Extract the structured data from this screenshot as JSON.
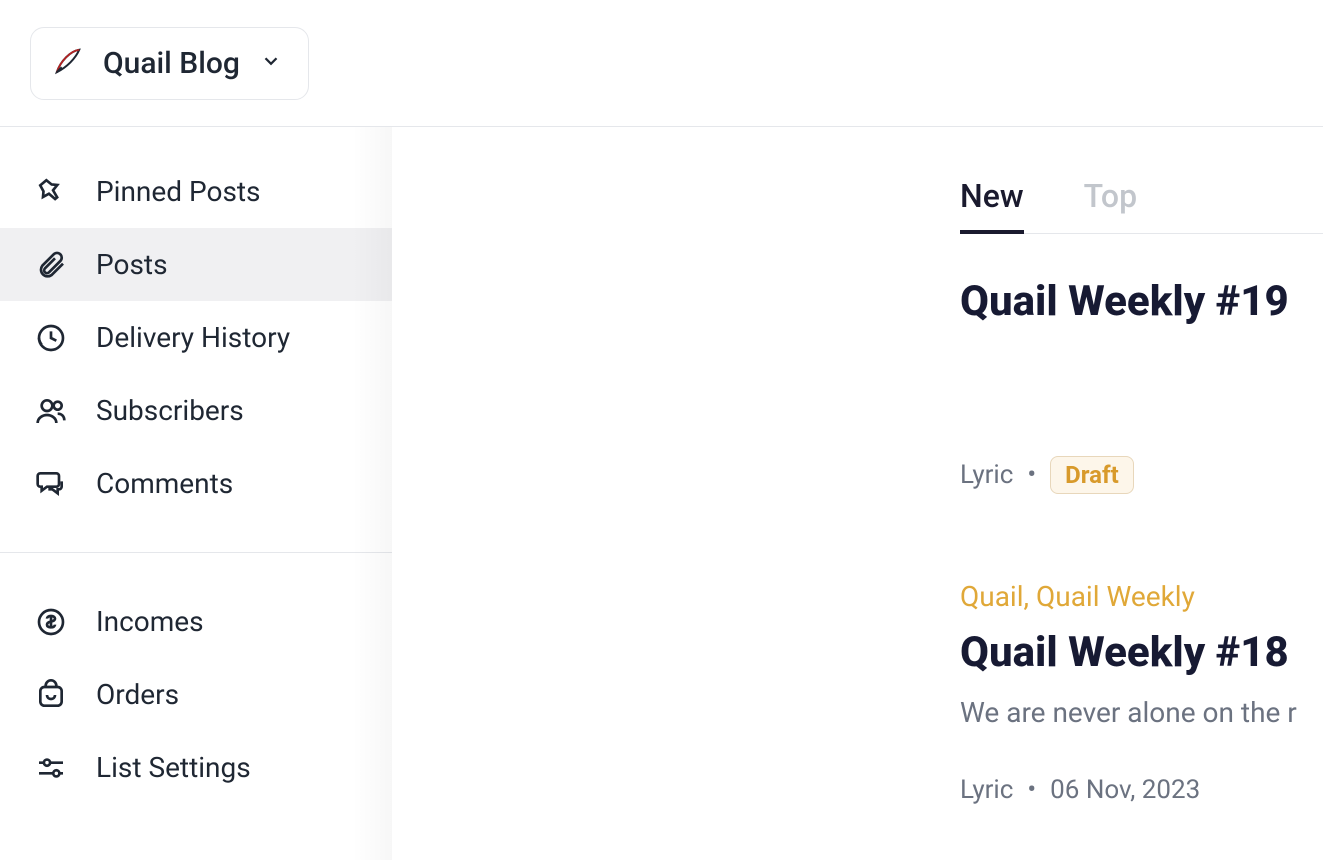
{
  "header": {
    "site_name": "Quail Blog"
  },
  "sidebar": {
    "section1": [
      {
        "key": "pinned",
        "label": "Pinned Posts"
      },
      {
        "key": "posts",
        "label": "Posts"
      },
      {
        "key": "delivery",
        "label": "Delivery History"
      },
      {
        "key": "subs",
        "label": "Subscribers"
      },
      {
        "key": "comments",
        "label": "Comments"
      }
    ],
    "section2": [
      {
        "key": "incomes",
        "label": "Incomes"
      },
      {
        "key": "orders",
        "label": "Orders"
      },
      {
        "key": "settings",
        "label": "List Settings"
      }
    ],
    "active_key": "posts"
  },
  "tabs": {
    "items": [
      "New",
      "Top"
    ],
    "active_index": 0
  },
  "posts": [
    {
      "title": "Quail Weekly #19",
      "categories": "",
      "excerpt": "",
      "author": "Lyric",
      "date": "",
      "status": "Draft"
    },
    {
      "title": "Quail Weekly #18",
      "categories": "Quail, Quail Weekly",
      "excerpt": "We are never alone on the r",
      "author": "Lyric",
      "date": "06 Nov, 2023",
      "status": ""
    }
  ]
}
